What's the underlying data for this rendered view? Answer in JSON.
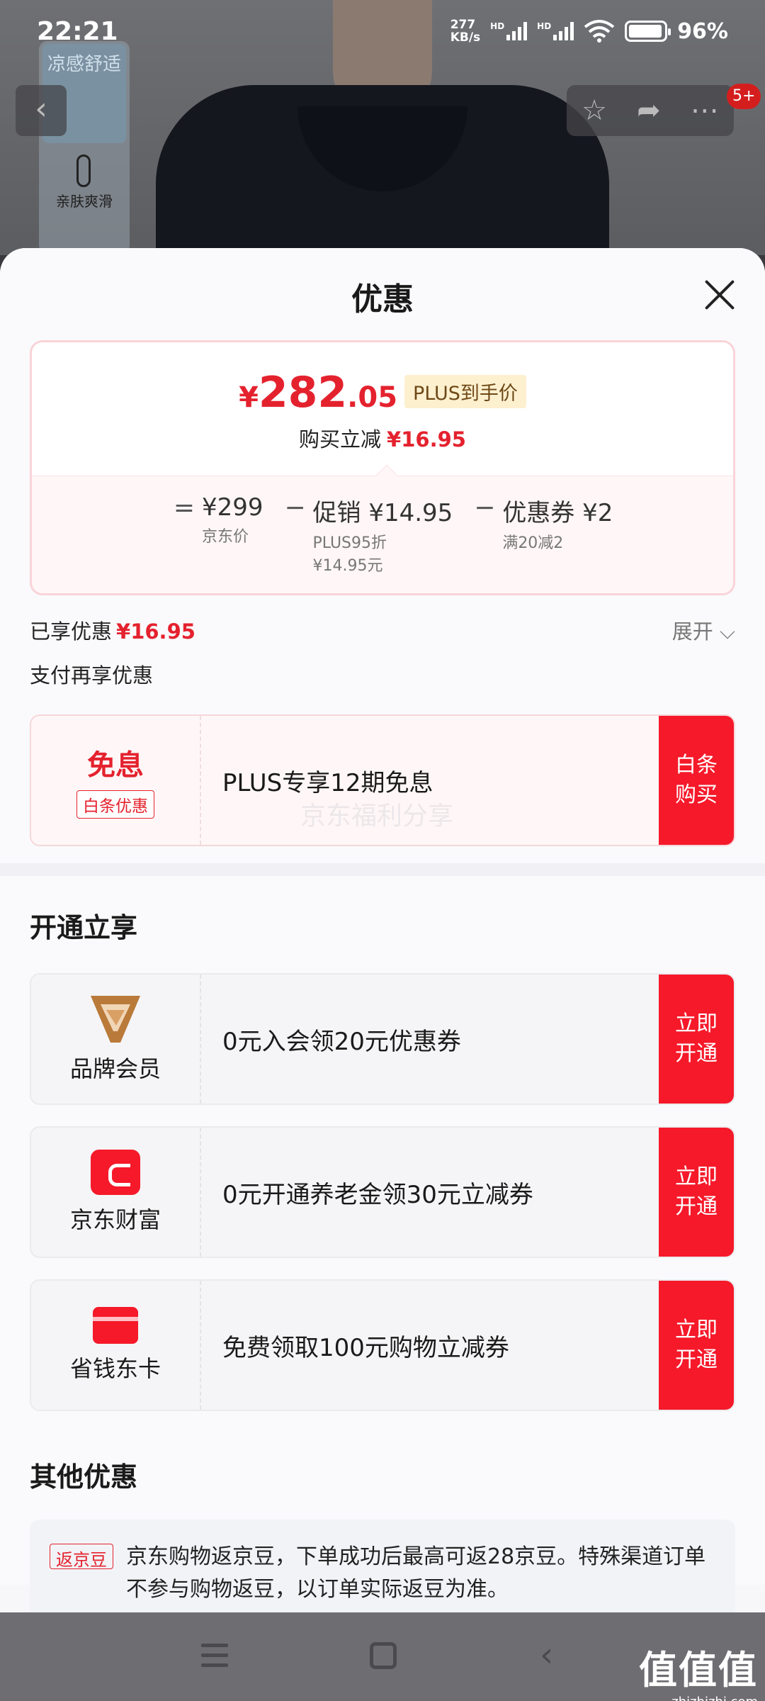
{
  "status_bar": {
    "time": "22:21",
    "net_speed_top": "277",
    "net_speed_bottom": "KB/s",
    "hd1": "HD",
    "hd2": "HD",
    "battery_percent": "96%",
    "battery_level": 0.96
  },
  "background": {
    "tag_top": "凉感舒适",
    "tag_mid": "亲肤爽滑"
  },
  "top_actions": {
    "badge": "5+",
    "icons": [
      "star-icon",
      "share-icon",
      "more-icon"
    ]
  },
  "sheet": {
    "title": "优惠",
    "price": {
      "currency": "¥",
      "integer": "282",
      "decimal": ".05",
      "plus_tag": "PLUS到手价",
      "reduce_label": "购买立减",
      "reduce_value": "¥16.95"
    },
    "calc": {
      "equals": "=",
      "minus1": "−",
      "minus2": "−",
      "jd_price": "¥299",
      "jd_price_label": "京东价",
      "promo": "促销 ¥14.95",
      "promo_sub1": "PLUS95折",
      "promo_sub2": "¥14.95元",
      "coupon": "优惠券 ¥2",
      "coupon_sub": "满20减2"
    },
    "enjoyed_label": "已享优惠",
    "enjoyed_value": "¥16.95",
    "expand": "展开 ⌵",
    "pay_again": "支付再享优惠",
    "baitiao": {
      "left_title": "免息",
      "left_tag": "白条优惠",
      "text": "PLUS专享12期免息",
      "button": "白条购买",
      "watermark": "京东福利分享"
    },
    "open_section_title": "开通立享",
    "open_items": [
      {
        "label": "品牌会员",
        "text": "0元入会领20元优惠券",
        "button": "立即开通"
      },
      {
        "label": "京东财富",
        "text": "0元开通养老金领30元立减券",
        "button": "立即开通"
      },
      {
        "label": "省钱东卡",
        "text": "免费领取100元购物立减券",
        "button": "立即开通"
      }
    ],
    "other_title": "其他优惠",
    "fanjd": {
      "tag": "返京豆",
      "text": "京东购物返京豆，下单成功后最高可返28京豆。特殊渠道订单不参与购物返豆，以订单实际返豆为准。"
    }
  },
  "watermark_logo": {
    "big": "值值值",
    "small": "zhizhizhi.com"
  },
  "colors": {
    "accent_red": "#e4222e",
    "button_red": "#f5192a",
    "plus_tag_bg": "#fdf0cf"
  }
}
